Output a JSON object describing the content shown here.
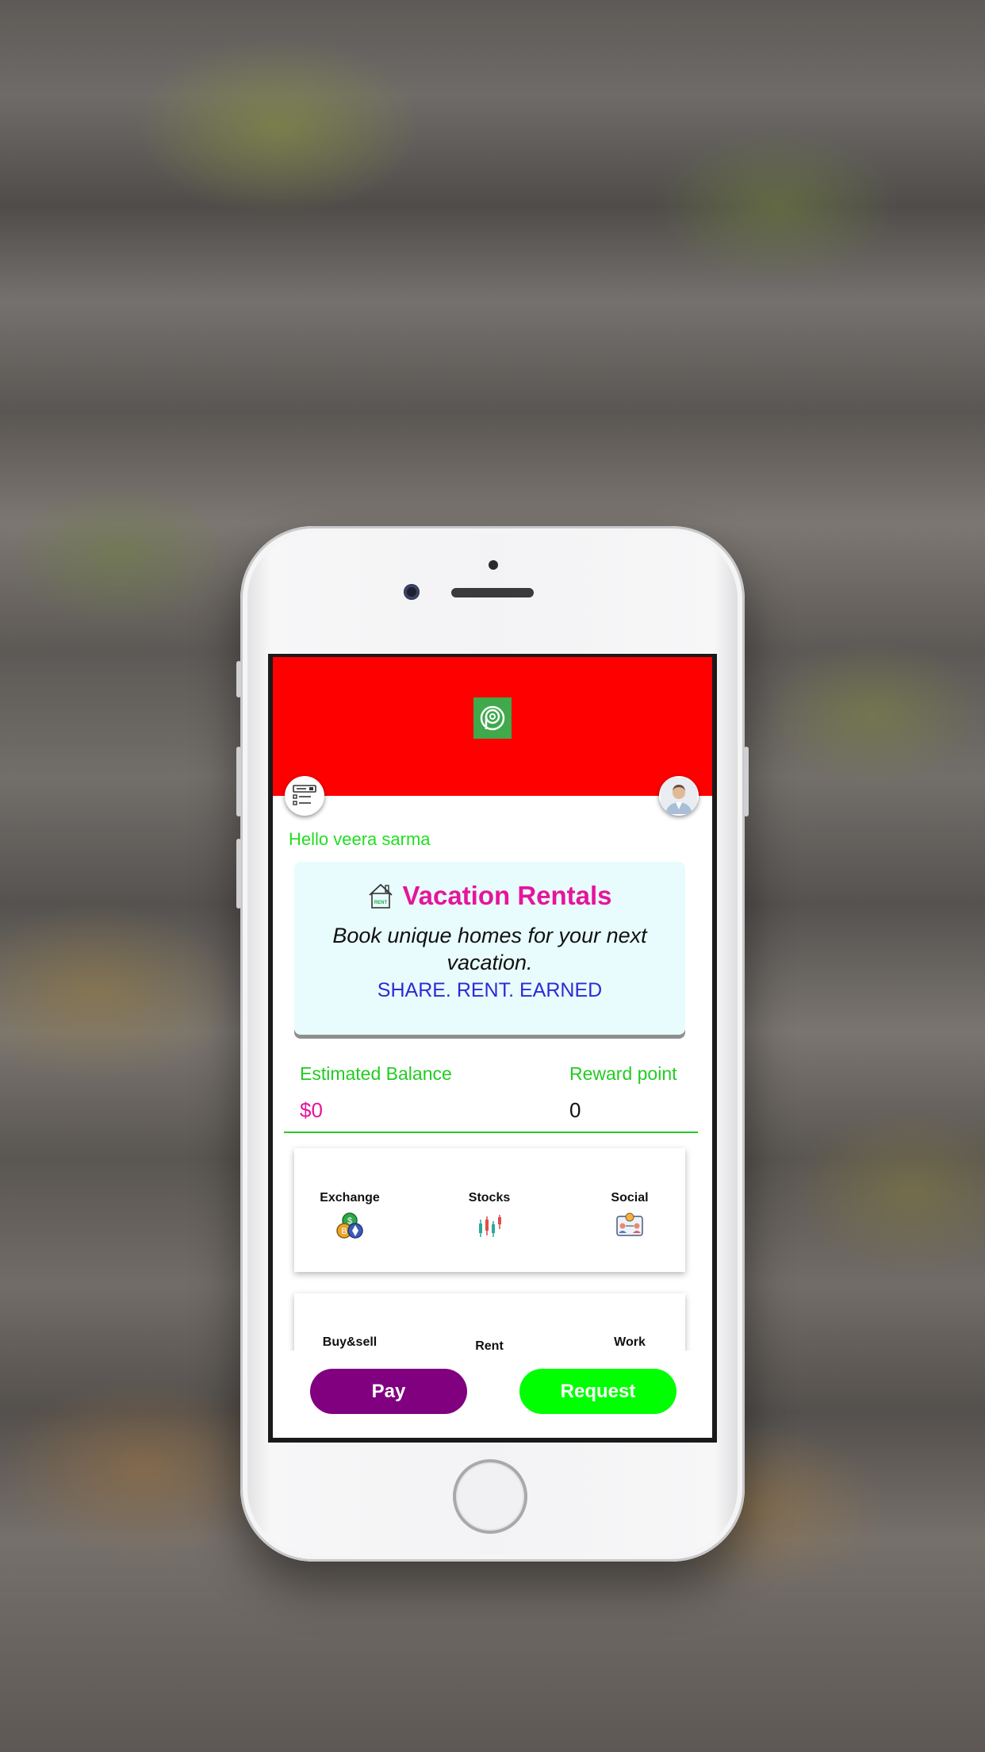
{
  "app": {
    "greeting": "Hello veera sarma",
    "promo": {
      "title": "Vacation Rentals",
      "subtitle": "Book unique homes for your next vacation.",
      "tagline": "SHARE. RENT. EARNED",
      "icon_badge": "RENT"
    },
    "balance": {
      "estimated_label": "Estimated Balance",
      "estimated_value": "$0",
      "reward_label": "Reward point",
      "reward_value": "0"
    },
    "services_row1": [
      "Exchange",
      "Stocks",
      "Social"
    ],
    "services_row2": [
      "Buy&sell",
      "Rent",
      "Work"
    ],
    "actions": {
      "pay": "Pay",
      "request": "Request"
    }
  },
  "icons": {
    "header_logo": "app-logo-icon",
    "menu": "menu-list-icon",
    "profile": "avatar-icon",
    "promo": "house-rent-icon",
    "exchange": "coins-icon",
    "stocks": "candlestick-chart-icon",
    "social": "social-network-icon"
  },
  "colors": {
    "header": "#ff0000",
    "logo": "#3fa94b",
    "greeting": "#22dd22",
    "promo_bg": "#e8fcfd",
    "promo_title": "#e5159c",
    "promo_tagline": "#2b2bd6",
    "balance_value": "#e5159c",
    "pay_button": "#800080",
    "request_button": "#00ff00"
  }
}
